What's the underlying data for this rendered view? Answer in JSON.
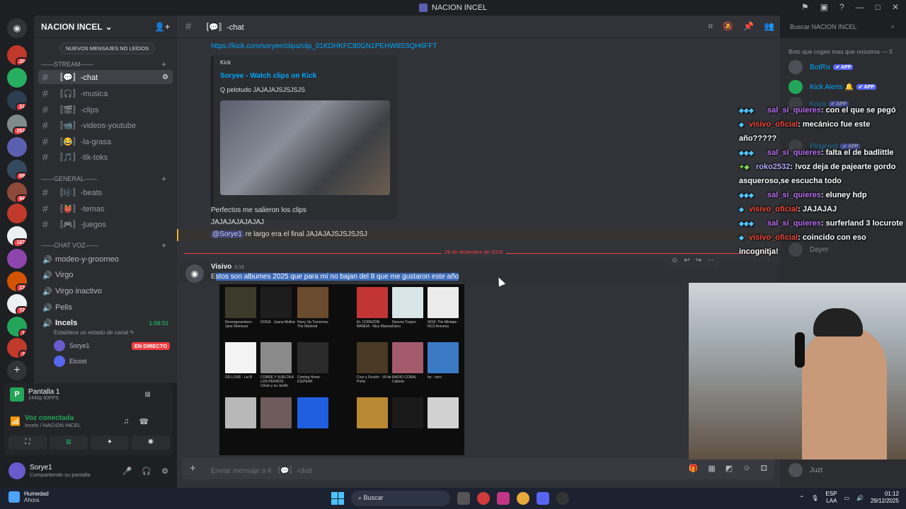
{
  "window": {
    "title": "NACION INCEL"
  },
  "server": {
    "name": "NACION INCEL",
    "unread_pill": "NUEVOS MENSAJES NO LEÍDOS",
    "badges": [
      "20",
      "31",
      "263",
      "69",
      "94",
      "187",
      "13",
      "72",
      "1",
      "3"
    ]
  },
  "channels": {
    "categories": {
      "stream": "——STREAM——",
      "general": "——GENERAL——",
      "voz": "——CHAT VOZ——"
    },
    "stream": [
      "〚💬〛-chat",
      "〚🎧〛-musica",
      "〚🎬〛-clips",
      "〚📹〛-videos-youtube",
      "〚😂〛-la-grasa",
      "〚🎵〛-tik-toks"
    ],
    "general": [
      "〚🎼〛-beats",
      "〚👹〛-temas",
      "〚🎮〛-juegos"
    ],
    "voice": [
      "modeo-y-groomeo",
      "Virgo",
      "Virgo inactivo",
      "Pelis",
      "Incels"
    ],
    "incels_time": "1:58:51",
    "incels_status": "Establece un estado de canal ✎",
    "voice_users": [
      {
        "name": "Sorye1",
        "live": "EN DIRECTO"
      },
      {
        "name": "Eicost"
      }
    ]
  },
  "stream_panel": {
    "title": "Pantalla 1",
    "quality": "1440p 60FPS",
    "connected": "Voz conectada",
    "location": "Incels / NACION INCEL"
  },
  "user": {
    "name": "Sorye1",
    "status": "Compartiendo su pantalla"
  },
  "chat": {
    "channel": "〚💬〛-chat",
    "search_placeholder": "Buscar NACION INCEL",
    "link": "https://kick.com/soryee/clips/clip_01KDHKFC80GN1PEHW8SSQH6FFT",
    "embed": {
      "provider": "Kick",
      "title": "Soryee - Watch clips on Kick",
      "desc": "Q pelotudo JAJAJAJSJSJSJS"
    },
    "lines": [
      "Perfectos me salieron los clips",
      "JAJAJAJAJAJAJ"
    ],
    "mention": "@Sorye1",
    "mention_text": " re largo era el final JAJAJAJSJSJSJSJ",
    "date": "29 de diciembre de 2025",
    "author": "Visivo",
    "author_time": "0:19",
    "message_first": "E",
    "message_selected": "stos son albumes 2025 que para mí no bajan del 8 que me gustaron este año",
    "composer_placeholder": "Enviar mensaje a # 〚💬〛-chat",
    "albums": [
      {
        "cap": "Revengeseekerz\nJane Remover",
        "color": "#3c3a2a"
      },
      {
        "cap": "DOGA\nJuana Molina",
        "color": "#1d1d1d"
      },
      {
        "cap": "Hurry Up Tomorrow\nThe Weeknd",
        "color": "#6b4b2e"
      },
      {
        "cap": "EL CORAZÓN MANDA\nNico Miseria",
        "color": "#c23535"
      },
      {
        "cap": "Nuevos Trapos\nDano",
        "color": "#d9e6e8"
      },
      {
        "cap": "0018: The Mixtape\nNCS Arsvena",
        "color": "#ececec"
      },
      {
        "cap": "OG LOVE\nLei B",
        "color": "#f3f3f3"
      },
      {
        "cap": "CORRE Y SUELTA A LOS PERROS\nCésar y su Jardín",
        "color": "#8a8a8a"
      },
      {
        "cap": "Coming Home\nICEPEAK",
        "color": "#2a2a2a"
      },
      {
        "cap": "Crux y Ficción\nVil de Porta",
        "color": "#4a3a25"
      },
      {
        "cap": "RADIO CORAL\nCalonia",
        "color": "#a35b6c"
      },
      {
        "cap": "he\ncero",
        "color": "#3a7ac4"
      },
      {
        "cap": "",
        "color": "#b8b8b8"
      },
      {
        "cap": "",
        "color": "#6d5a5a"
      },
      {
        "cap": "",
        "color": "#1f5fe0"
      },
      {
        "cap": "",
        "color": "#b98833"
      },
      {
        "cap": "",
        "color": "#1a1a1a"
      },
      {
        "cap": "",
        "color": "#d1d1d1"
      }
    ]
  },
  "members": {
    "category": "Bots que cogen mas que nosotros — 5",
    "list": [
      {
        "name": "BotRix",
        "tag": "✔ APP"
      },
      {
        "name": "Kick Alerts 🔔",
        "tag": "✔ APP"
      },
      {
        "name": "Koya",
        "tag": "✔ APP"
      },
      {
        "name": "Pingcord",
        "tag": "✔ APP"
      },
      {
        "name": "Dayer"
      },
      {
        "name": "Juzt"
      }
    ]
  },
  "overlay": [
    {
      "user": "sal_si_quieres",
      "text": ": con el que se pegó"
    },
    {
      "user": "visivo_oficial",
      "text": ": mecánico fue este año?????"
    },
    {
      "user": "sal_si_quieres",
      "text": ": falta el de badlittle"
    },
    {
      "user": "roko2532",
      "text": ": !voz deja de pajearte gordo asqueroso,se escucha todo"
    },
    {
      "user": "sal_si_quieres",
      "text": ": eluney hdp"
    },
    {
      "user": "visivo_oficial",
      "text": ": JAJAJAJ"
    },
    {
      "user": "sal_si_quieres",
      "text": ": surferland 3 locurote"
    },
    {
      "user": "visivo_oficial",
      "text": ": coincido con eso incognitja!"
    }
  ],
  "taskbar": {
    "weather_title": "Humedad",
    "weather_sub": "Ahora",
    "search": "Buscar",
    "lang": "ESP",
    "lang2": "LAA",
    "time": "01:12",
    "date": "29/12/2025"
  },
  "colors": {
    "discord_accent": "#5865f2",
    "live": "#f23f43",
    "connected": "#23a55a",
    "link": "#00a8fc"
  }
}
